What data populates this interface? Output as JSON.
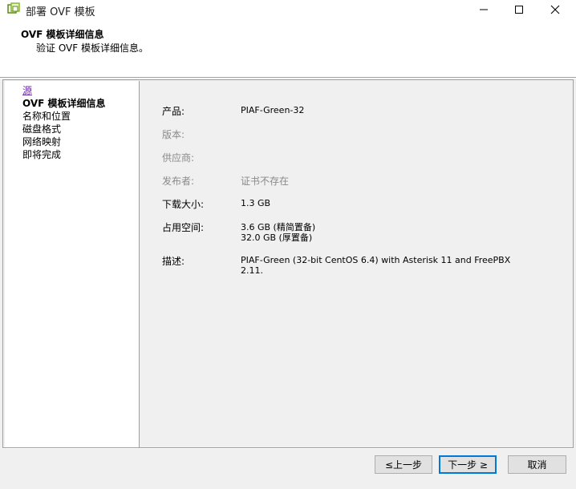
{
  "window": {
    "title": "部署 OVF 模板",
    "minimize_icon": "minimize-icon",
    "maximize_icon": "maximize-icon",
    "close_icon": "close-icon"
  },
  "header": {
    "title": "OVF 模板详细信息",
    "subtitle": "验证 OVF 模板详细信息。"
  },
  "steps": [
    {
      "label": "源",
      "state": "link"
    },
    {
      "label": "OVF 模板详细信息",
      "state": "current"
    },
    {
      "label": "名称和位置",
      "state": "normal"
    },
    {
      "label": "磁盘格式",
      "state": "normal"
    },
    {
      "label": "网络映射",
      "state": "normal"
    },
    {
      "label": "即将完成",
      "state": "normal"
    }
  ],
  "details": {
    "product_label": "产品:",
    "product_value": "PIAF-Green-32",
    "version_label": "版本:",
    "version_value": "",
    "vendor_label": "供应商:",
    "vendor_value": "",
    "publisher_label": "发布者:",
    "publisher_value": "证书不存在",
    "download_label": "下载大小:",
    "download_value": "1.3 GB",
    "disk_label": "占用空间:",
    "disk_value_thin": "3.6 GB (精简置备)",
    "disk_value_thick": "32.0 GB (厚置备)",
    "desc_label": "描述:",
    "desc_line1": "PIAF-Green (32-bit CentOS 6.4) with Asterisk 11 and FreePBX",
    "desc_line2": "2.11."
  },
  "buttons": {
    "back": "≤上一步",
    "next": "下一步 ≥",
    "cancel": "取消"
  },
  "colors": {
    "link": "#6a2aa6",
    "dim_text": "#8a8a8a",
    "focus_border": "#0078d7"
  }
}
